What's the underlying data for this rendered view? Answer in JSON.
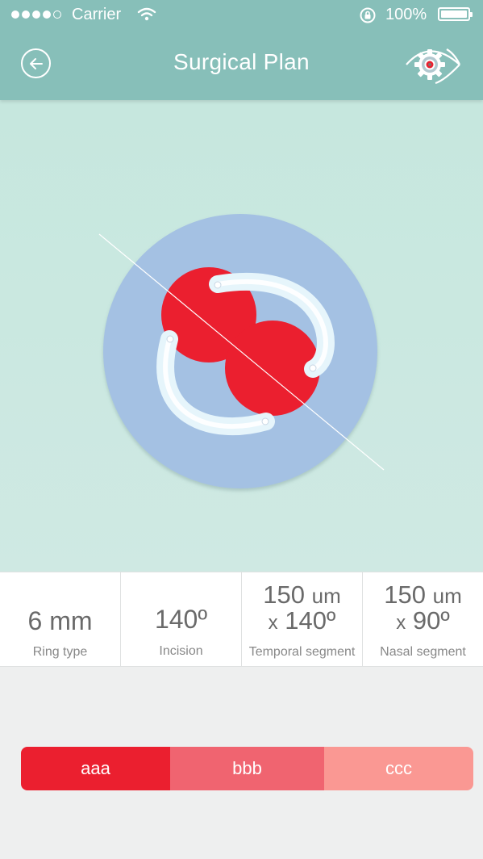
{
  "status_bar": {
    "signal_bars": 4,
    "signal_total": 5,
    "carrier": "Carrier",
    "wifi_icon": "wifi-icon",
    "lock_icon": "rotation-lock-icon",
    "battery_percent": "100%",
    "battery_level": 1.0
  },
  "nav": {
    "title": "Surgical Plan",
    "back_icon": "back-arrow-icon",
    "settings_icon": "eye-gear-icon"
  },
  "diagram": {
    "ring_color": "#a4c1e3",
    "pattern_color": "#eb1f2f",
    "segment_color": "#e6f5fb",
    "incision_line_color": "#ffffff"
  },
  "info": {
    "ring_type": {
      "value": "6 mm",
      "label": "Ring type"
    },
    "incision": {
      "value": "140º",
      "label": "Incision"
    },
    "temporal": {
      "size": "150",
      "size_unit": "um",
      "prefix": "x",
      "angle": "140º",
      "label": "Temporal segment"
    },
    "nasal": {
      "size": "150",
      "size_unit": "um",
      "prefix": "x",
      "angle": "90º",
      "label": "Nasal segment"
    }
  },
  "segments": {
    "items": [
      {
        "label": "aaa",
        "color": "#eb1f2f"
      },
      {
        "label": "bbb",
        "color": "#f06470"
      },
      {
        "label": "ccc",
        "color": "#fa9893"
      }
    ]
  }
}
